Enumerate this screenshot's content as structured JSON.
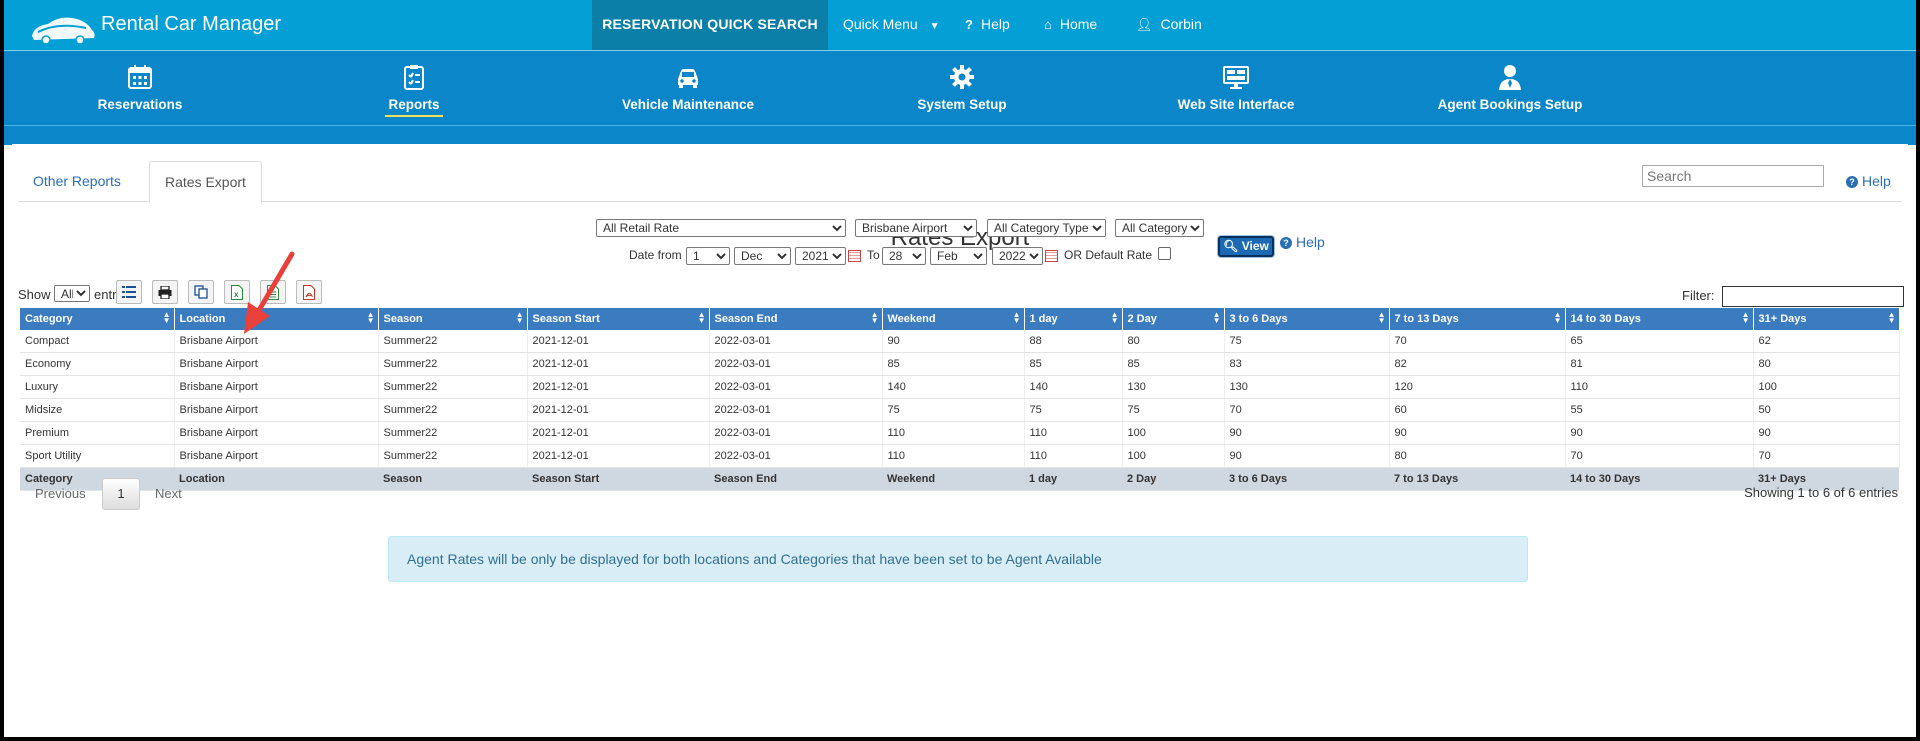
{
  "app": {
    "title": "Rental Car Manager"
  },
  "topnav": {
    "quick_search": "RESERVATION QUICK SEARCH",
    "quick_menu": "Quick Menu",
    "help": "Help",
    "home": "Home",
    "user": "Corbin"
  },
  "modules": [
    {
      "label": "Reservations",
      "icon": "calendar-icon"
    },
    {
      "label": "Reports",
      "icon": "clipboard-icon",
      "active": true
    },
    {
      "label": "Vehicle Maintenance",
      "icon": "car-icon"
    },
    {
      "label": "System Setup",
      "icon": "gear-icon"
    },
    {
      "label": "Web Site Interface",
      "icon": "monitor-icon"
    },
    {
      "label": "Agent Bookings Setup",
      "icon": "agent-icon"
    }
  ],
  "tabs": [
    {
      "label": "Other Reports"
    },
    {
      "label": "Rates Export",
      "active": true
    }
  ],
  "search": {
    "placeholder": "Search"
  },
  "help_label": "Help",
  "page_title": "Rates Export",
  "filters": {
    "rate_type": "All Retail Rate",
    "location": "Brisbane Airport",
    "category_type": "All Category Type",
    "category": "All Category",
    "view_label": "View",
    "help_label": "Help",
    "date_from_label": "Date from",
    "from_day": "1",
    "from_month": "Dec",
    "from_year": "2021",
    "to_label": "To",
    "to_day": "28",
    "to_month": "Feb",
    "to_year": "2022",
    "default_rate_label": "OR Default Rate"
  },
  "table_controls": {
    "show_label": "Show",
    "show_value": "All",
    "entries_label": "entries",
    "filter_label": "Filter:"
  },
  "table": {
    "columns": [
      "Category",
      "Location",
      "Season",
      "Season Start",
      "Season End",
      "Weekend",
      "1 day",
      "2 Day",
      "3 to 6 Days",
      "7 to 13 Days",
      "14 to 30 Days",
      "31+ Days"
    ],
    "rows": [
      [
        "Compact",
        "Brisbane Airport",
        "Summer22",
        "2021-12-01",
        "2022-03-01",
        "90",
        "88",
        "80",
        "75",
        "70",
        "65",
        "62"
      ],
      [
        "Economy",
        "Brisbane Airport",
        "Summer22",
        "2021-12-01",
        "2022-03-01",
        "85",
        "85",
        "85",
        "83",
        "82",
        "81",
        "80"
      ],
      [
        "Luxury",
        "Brisbane Airport",
        "Summer22",
        "2021-12-01",
        "2022-03-01",
        "140",
        "140",
        "130",
        "130",
        "120",
        "110",
        "100"
      ],
      [
        "Midsize",
        "Brisbane Airport",
        "Summer22",
        "2021-12-01",
        "2022-03-01",
        "75",
        "75",
        "75",
        "70",
        "60",
        "55",
        "50"
      ],
      [
        "Premium",
        "Brisbane Airport",
        "Summer22",
        "2021-12-01",
        "2022-03-01",
        "110",
        "110",
        "100",
        "90",
        "90",
        "90",
        "90"
      ],
      [
        "Sport Utility",
        "Brisbane Airport",
        "Summer22",
        "2021-12-01",
        "2022-03-01",
        "110",
        "110",
        "100",
        "90",
        "80",
        "70",
        "70"
      ]
    ]
  },
  "pagination": {
    "previous": "Previous",
    "page": "1",
    "next": "Next",
    "showing": "Showing 1 to 6 of 6 entries"
  },
  "notice": "Agent Rates will be only be displayed for both locations and Categories that have been set to be Agent Available",
  "colors": {
    "topbar": "#049fd4",
    "modbar": "#0b86c8",
    "table_header": "#3b7bbf",
    "arrow": "#e8413c"
  }
}
